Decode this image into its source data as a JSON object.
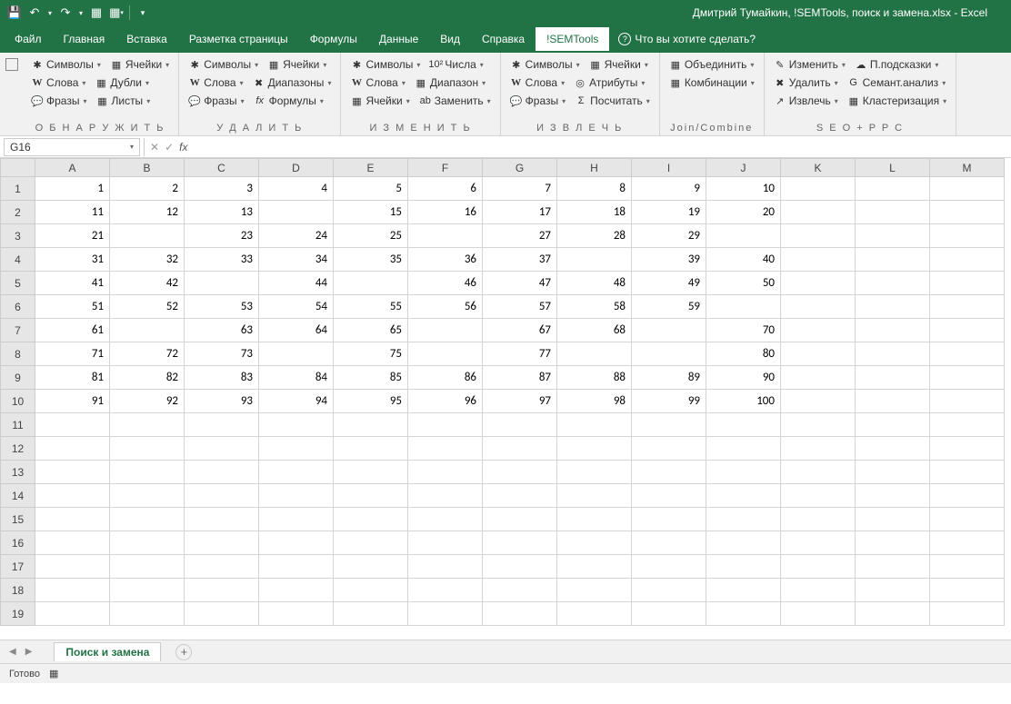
{
  "title": "Дмитрий Тумайкин, !SEMTools, поиск и замена.xlsx  -  Excel",
  "menu": [
    "Файл",
    "Главная",
    "Вставка",
    "Разметка страницы",
    "Формулы",
    "Данные",
    "Вид",
    "Справка",
    "!SEMTools"
  ],
  "active_menu": "!SEMTools",
  "tellme": "Что вы хотите сделать?",
  "ribbon": {
    "g1": {
      "label": "О Б Н А Р У Ж И Т Ь",
      "r1": [
        {
          "t": "Символы",
          "i": "✱"
        },
        {
          "t": "Ячейки",
          "i": "▦"
        }
      ],
      "r2": [
        {
          "t": "Слова",
          "i": "W"
        },
        {
          "t": "Дубли",
          "i": "▦"
        }
      ],
      "r3": [
        {
          "t": "Фразы",
          "i": "💬"
        },
        {
          "t": "Листы",
          "i": "▦"
        }
      ]
    },
    "g2": {
      "label": "У Д А Л И Т Ь",
      "r1": [
        {
          "t": "Символы",
          "i": "✱"
        },
        {
          "t": "Ячейки",
          "i": "▦"
        }
      ],
      "r2": [
        {
          "t": "Слова",
          "i": "W"
        },
        {
          "t": "Диапазоны",
          "i": "✖"
        }
      ],
      "r3": [
        {
          "t": "Фразы",
          "i": "💬"
        },
        {
          "t": "Формулы",
          "i": "fx"
        }
      ]
    },
    "g3": {
      "label": "И З М Е Н И Т Ь",
      "r1": [
        {
          "t": "Символы",
          "i": "✱"
        },
        {
          "t": "Числа",
          "i": "10²"
        }
      ],
      "r2": [
        {
          "t": "Слова",
          "i": "W"
        },
        {
          "t": "Диапазон",
          "i": "▦"
        }
      ],
      "r3": [
        {
          "t": "Ячейки",
          "i": "▦"
        },
        {
          "t": "Заменить",
          "i": "ab"
        }
      ]
    },
    "g4": {
      "label": "И З В Л Е Ч Ь",
      "r1": [
        {
          "t": "Символы",
          "i": "✱"
        },
        {
          "t": "Ячейки",
          "i": "▦"
        }
      ],
      "r2": [
        {
          "t": "Слова",
          "i": "W"
        },
        {
          "t": "Атрибуты",
          "i": "◎"
        }
      ],
      "r3": [
        {
          "t": "Фразы",
          "i": "💬"
        },
        {
          "t": "Посчитать",
          "i": "Σ"
        }
      ]
    },
    "g5": {
      "label": "Join/Combine",
      "r1": [
        {
          "t": "Объединить",
          "i": "▦"
        }
      ],
      "r2": [
        {
          "t": "Комбинации",
          "i": "▦"
        }
      ]
    },
    "g6": {
      "label": "S E O + P P C",
      "r1": [
        {
          "t": "Изменить",
          "i": "✎"
        },
        {
          "t": "П.подсказки",
          "i": "☁"
        }
      ],
      "r2": [
        {
          "t": "Удалить",
          "i": "✖"
        },
        {
          "t": "Семант.анализ",
          "i": "G"
        }
      ],
      "r3": [
        {
          "t": "Извлечь",
          "i": "↗"
        },
        {
          "t": "Кластеризация",
          "i": "▦"
        }
      ]
    }
  },
  "namebox": "G16",
  "columns": [
    "A",
    "B",
    "C",
    "D",
    "E",
    "F",
    "G",
    "H",
    "I",
    "J",
    "K",
    "L",
    "M"
  ],
  "rows": [
    1,
    2,
    3,
    4,
    5,
    6,
    7,
    8,
    9,
    10,
    11,
    12,
    13,
    14,
    15,
    16,
    17,
    18,
    19
  ],
  "data": [
    [
      1,
      2,
      3,
      4,
      5,
      6,
      7,
      8,
      9,
      10,
      "",
      "",
      ""
    ],
    [
      11,
      12,
      13,
      "",
      15,
      16,
      17,
      18,
      19,
      20,
      "",
      "",
      ""
    ],
    [
      21,
      "",
      23,
      24,
      25,
      "",
      27,
      28,
      29,
      "",
      "",
      "",
      ""
    ],
    [
      31,
      32,
      33,
      34,
      35,
      36,
      37,
      "",
      39,
      40,
      "",
      "",
      ""
    ],
    [
      41,
      42,
      "",
      44,
      "",
      46,
      47,
      48,
      49,
      50,
      "",
      "",
      ""
    ],
    [
      51,
      52,
      53,
      54,
      55,
      56,
      57,
      58,
      59,
      "",
      "",
      "",
      ""
    ],
    [
      61,
      "",
      63,
      64,
      65,
      "",
      67,
      68,
      "",
      70,
      "",
      "",
      ""
    ],
    [
      71,
      72,
      73,
      "",
      75,
      "",
      77,
      "",
      "",
      80,
      "",
      "",
      ""
    ],
    [
      81,
      82,
      83,
      84,
      85,
      86,
      87,
      88,
      89,
      90,
      "",
      "",
      ""
    ],
    [
      91,
      92,
      93,
      94,
      95,
      96,
      97,
      98,
      99,
      100,
      "",
      "",
      ""
    ],
    [
      "",
      "",
      "",
      "",
      "",
      "",
      "",
      "",
      "",
      "",
      "",
      "",
      ""
    ],
    [
      "",
      "",
      "",
      "",
      "",
      "",
      "",
      "",
      "",
      "",
      "",
      "",
      ""
    ],
    [
      "",
      "",
      "",
      "",
      "",
      "",
      "",
      "",
      "",
      "",
      "",
      "",
      ""
    ],
    [
      "",
      "",
      "",
      "",
      "",
      "",
      "",
      "",
      "",
      "",
      "",
      "",
      ""
    ],
    [
      "",
      "",
      "",
      "",
      "",
      "",
      "",
      "",
      "",
      "",
      "",
      "",
      ""
    ],
    [
      "",
      "",
      "",
      "",
      "",
      "",
      "",
      "",
      "",
      "",
      "",
      "",
      ""
    ],
    [
      "",
      "",
      "",
      "",
      "",
      "",
      "",
      "",
      "",
      "",
      "",
      "",
      ""
    ],
    [
      "",
      "",
      "",
      "",
      "",
      "",
      "",
      "",
      "",
      "",
      "",
      "",
      ""
    ],
    [
      "",
      "",
      "",
      "",
      "",
      "",
      "",
      "",
      "",
      "",
      "",
      "",
      ""
    ]
  ],
  "sheet_tab": "Поиск и замена",
  "status": "Готово"
}
